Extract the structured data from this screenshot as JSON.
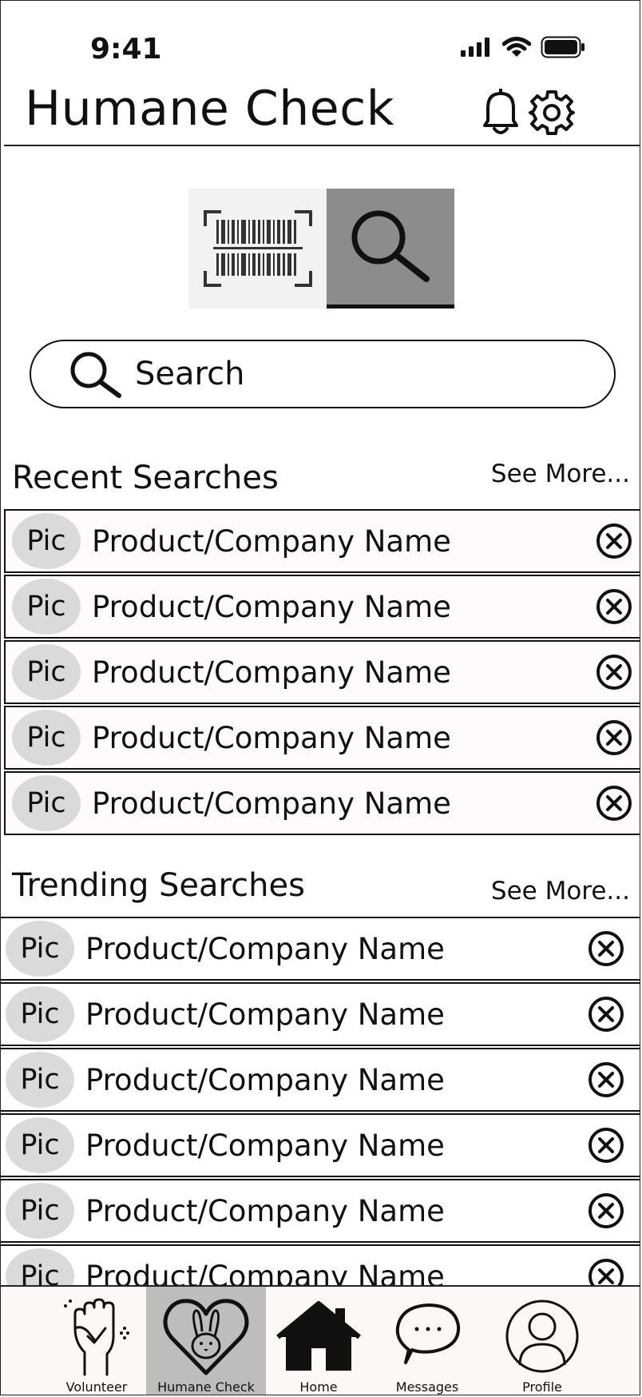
{
  "status": {
    "time": "9:41"
  },
  "header": {
    "title": "Humane Check",
    "icons": [
      "bell-icon",
      "gear-icon"
    ]
  },
  "mode_toggle": {
    "options": [
      "barcode-scan",
      "search"
    ],
    "selected": "search"
  },
  "search": {
    "placeholder": "Search"
  },
  "recent": {
    "title": "Recent Searches",
    "see_more": "See More...",
    "items": [
      {
        "pic": "Pic",
        "name": "Product/Company Name"
      },
      {
        "pic": "Pic",
        "name": "Product/Company Name"
      },
      {
        "pic": "Pic",
        "name": "Product/Company Name"
      },
      {
        "pic": "Pic",
        "name": "Product/Company Name"
      },
      {
        "pic": "Pic",
        "name": "Product/Company Name"
      }
    ]
  },
  "trending": {
    "title": "Trending Searches",
    "see_more": "See More...",
    "items": [
      {
        "pic": "Pic",
        "name": "Product/Company Name"
      },
      {
        "pic": "Pic",
        "name": "Product/Company Name"
      },
      {
        "pic": "Pic",
        "name": "Product/Company Name"
      },
      {
        "pic": "Pic",
        "name": "Product/Company Name"
      },
      {
        "pic": "Pic",
        "name": "Product/Company Name"
      },
      {
        "pic": "Pic",
        "name": "Product/Company Name"
      }
    ]
  },
  "tabs": [
    {
      "label": "Volunteer",
      "icon": "volunteer-hand-icon"
    },
    {
      "label": "Humane Check",
      "icon": "bunny-heart-icon",
      "active": true
    },
    {
      "label": "Home",
      "icon": "home-icon"
    },
    {
      "label": "Messages",
      "icon": "chat-bubble-icon"
    },
    {
      "label": "Profile",
      "icon": "profile-icon"
    }
  ]
}
